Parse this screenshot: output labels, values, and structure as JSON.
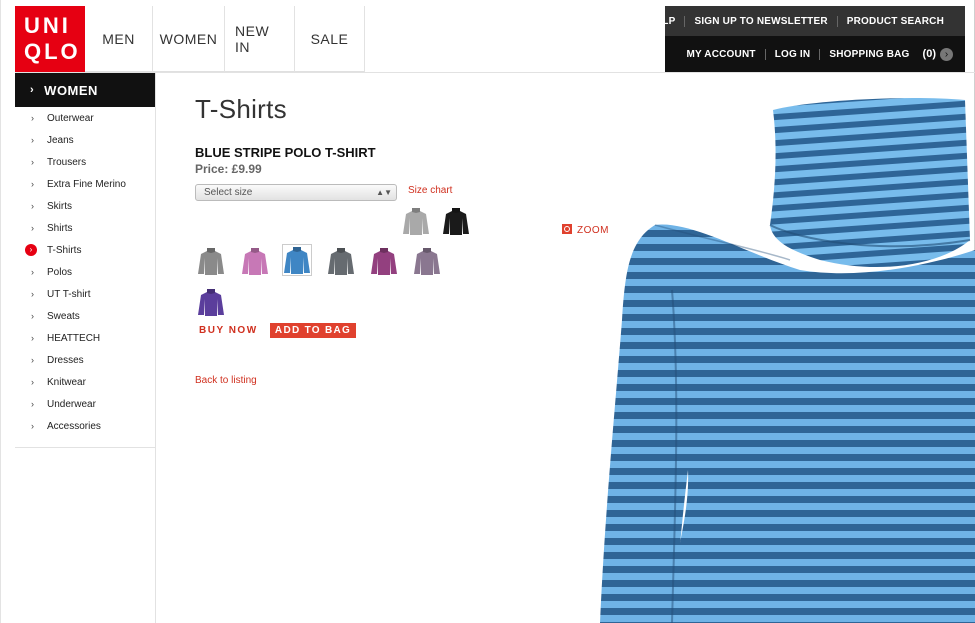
{
  "brand": {
    "line1": "UNI",
    "line2": "QLO"
  },
  "topnav": [
    "MEN",
    "WOMEN",
    "NEW IN",
    "SALE"
  ],
  "utility": {
    "row1": [
      "HELP",
      "SIGN UP TO NEWSLETTER",
      "PRODUCT SEARCH"
    ],
    "row2": [
      "MY ACCOUNT",
      "LOG IN",
      "SHOPPING BAG"
    ],
    "bag_count": "(0)"
  },
  "sidebar": {
    "heading": "WOMEN",
    "items": [
      {
        "label": "Outerwear"
      },
      {
        "label": "Jeans"
      },
      {
        "label": "Trousers"
      },
      {
        "label": "Extra Fine Merino"
      },
      {
        "label": "Skirts"
      },
      {
        "label": "Shirts"
      },
      {
        "label": "T-Shirts",
        "active": true
      },
      {
        "label": "Polos"
      },
      {
        "label": "UT T-shirt"
      },
      {
        "label": "Sweats"
      },
      {
        "label": "HEATTECH"
      },
      {
        "label": "Dresses"
      },
      {
        "label": "Knitwear"
      },
      {
        "label": "Underwear"
      },
      {
        "label": "Accessories"
      }
    ]
  },
  "main": {
    "page_title": "T-Shirts",
    "product_name": "BLUE STRIPE POLO T-SHIRT",
    "price": "Price: £9.99",
    "size_select": "Select size",
    "size_chart": "Size chart",
    "zoom": "ZOOM",
    "buy_now": "BUY NOW",
    "add_to_bag": "ADD TO BAG",
    "back": "Back to listing"
  },
  "swatches": [
    {
      "name": "light-grey",
      "color": "#a9a9a9",
      "selected": false
    },
    {
      "name": "black",
      "color": "#1a1a1a",
      "selected": false
    },
    {
      "name": "grey",
      "color": "#8a8a8a",
      "selected": false
    },
    {
      "name": "pink",
      "color": "#c778b6",
      "selected": false
    },
    {
      "name": "blue",
      "color": "#3f86c4",
      "selected": true
    },
    {
      "name": "charcoal",
      "color": "#666b70",
      "selected": false
    },
    {
      "name": "purple",
      "color": "#93407f",
      "selected": false
    },
    {
      "name": "mauve",
      "color": "#8a7790",
      "selected": false
    },
    {
      "name": "violet",
      "color": "#5b3e9c",
      "selected": false
    }
  ],
  "colors": {
    "accent": "#e0412e",
    "brand": "#e60012",
    "stripe_dark": "#2a5a8c",
    "stripe_light": "#6fb3e6"
  }
}
